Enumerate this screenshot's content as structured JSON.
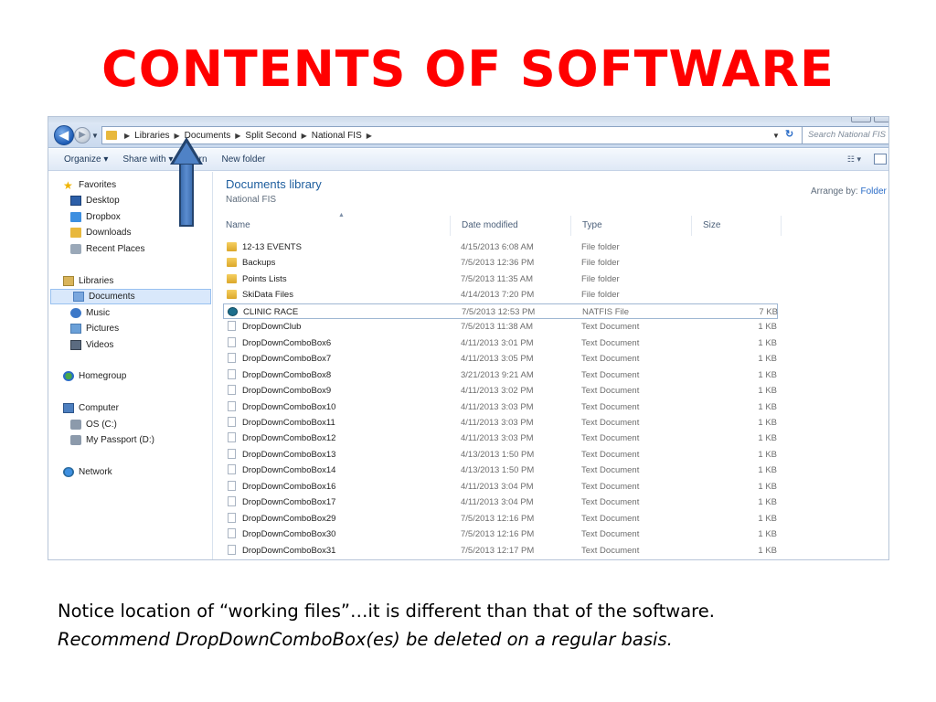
{
  "slide": {
    "title": "CONTENTS OF SOFTWARE",
    "caption_line1": "Notice location of “working files”…it is different than that of the software.",
    "caption_line2": "Recommend DropDownComboBox(es) be deleted on a regular basis."
  },
  "explorer": {
    "breadcrumb": [
      "Libraries",
      "Documents",
      "Split Second",
      "National FIS"
    ],
    "search_placeholder": "Search National FIS",
    "toolbar": {
      "organize": "Organize ▾",
      "share_with": "Share with ▾",
      "burn": "Burn",
      "new_folder": "New folder"
    },
    "nav": {
      "favorites": "Favorites",
      "desktop": "Desktop",
      "dropbox": "Dropbox",
      "downloads": "Downloads",
      "recent_places": "Recent Places",
      "libraries": "Libraries",
      "documents": "Documents",
      "music": "Music",
      "pictures": "Pictures",
      "videos": "Videos",
      "homegroup": "Homegroup",
      "computer": "Computer",
      "os_c": "OS (C:)",
      "my_passport": "My Passport (D:)",
      "network": "Network"
    },
    "content": {
      "library_title": "Documents library",
      "library_subtitle": "National FIS",
      "arrange_label": "Arrange by:",
      "arrange_value": "Folder",
      "columns": {
        "name": "Name",
        "date_modified": "Date modified",
        "type": "Type",
        "size": "Size"
      },
      "files": [
        {
          "name": "12-13 EVENTS",
          "date": "4/15/2013 6:08 AM",
          "type": "File folder",
          "size": "",
          "icon": "folder-icon"
        },
        {
          "name": "Backups",
          "date": "7/5/2013 12:36 PM",
          "type": "File folder",
          "size": "",
          "icon": "folder-icon"
        },
        {
          "name": "Points Lists",
          "date": "7/5/2013 11:35 AM",
          "type": "File folder",
          "size": "",
          "icon": "folder-icon"
        },
        {
          "name": "SkiData Files",
          "date": "4/14/2013 7:20 PM",
          "type": "File folder",
          "size": "",
          "icon": "folder-icon"
        },
        {
          "name": "CLINIC RACE",
          "date": "7/5/2013 12:53 PM",
          "type": "NATFIS File",
          "size": "7 KB",
          "icon": "natfis-file-icon"
        },
        {
          "name": "DropDownClub",
          "date": "7/5/2013 11:38 AM",
          "type": "Text Document",
          "size": "1 KB",
          "icon": "text-document-icon"
        },
        {
          "name": "DropDownComboBox6",
          "date": "4/11/2013 3:01 PM",
          "type": "Text Document",
          "size": "1 KB",
          "icon": "text-document-icon"
        },
        {
          "name": "DropDownComboBox7",
          "date": "4/11/2013 3:05 PM",
          "type": "Text Document",
          "size": "1 KB",
          "icon": "text-document-icon"
        },
        {
          "name": "DropDownComboBox8",
          "date": "3/21/2013 9:21 AM",
          "type": "Text Document",
          "size": "1 KB",
          "icon": "text-document-icon"
        },
        {
          "name": "DropDownComboBox9",
          "date": "4/11/2013 3:02 PM",
          "type": "Text Document",
          "size": "1 KB",
          "icon": "text-document-icon"
        },
        {
          "name": "DropDownComboBox10",
          "date": "4/11/2013 3:03 PM",
          "type": "Text Document",
          "size": "1 KB",
          "icon": "text-document-icon"
        },
        {
          "name": "DropDownComboBox11",
          "date": "4/11/2013 3:03 PM",
          "type": "Text Document",
          "size": "1 KB",
          "icon": "text-document-icon"
        },
        {
          "name": "DropDownComboBox12",
          "date": "4/11/2013 3:03 PM",
          "type": "Text Document",
          "size": "1 KB",
          "icon": "text-document-icon"
        },
        {
          "name": "DropDownComboBox13",
          "date": "4/13/2013 1:50 PM",
          "type": "Text Document",
          "size": "1 KB",
          "icon": "text-document-icon"
        },
        {
          "name": "DropDownComboBox14",
          "date": "4/13/2013 1:50 PM",
          "type": "Text Document",
          "size": "1 KB",
          "icon": "text-document-icon"
        },
        {
          "name": "DropDownComboBox16",
          "date": "4/11/2013 3:04 PM",
          "type": "Text Document",
          "size": "1 KB",
          "icon": "text-document-icon"
        },
        {
          "name": "DropDownComboBox17",
          "date": "4/11/2013 3:04 PM",
          "type": "Text Document",
          "size": "1 KB",
          "icon": "text-document-icon"
        },
        {
          "name": "DropDownComboBox29",
          "date": "7/5/2013 12:16 PM",
          "type": "Text Document",
          "size": "1 KB",
          "icon": "text-document-icon"
        },
        {
          "name": "DropDownComboBox30",
          "date": "7/5/2013 12:16 PM",
          "type": "Text Document",
          "size": "1 KB",
          "icon": "text-document-icon"
        },
        {
          "name": "DropDownComboBox31",
          "date": "7/5/2013 12:17 PM",
          "type": "Text Document",
          "size": "1 KB",
          "icon": "text-document-icon"
        }
      ]
    }
  },
  "colors": {
    "title_red": "#ff0000",
    "link_blue": "#1e5e9e",
    "arrow_blue": "#4f82c6"
  }
}
